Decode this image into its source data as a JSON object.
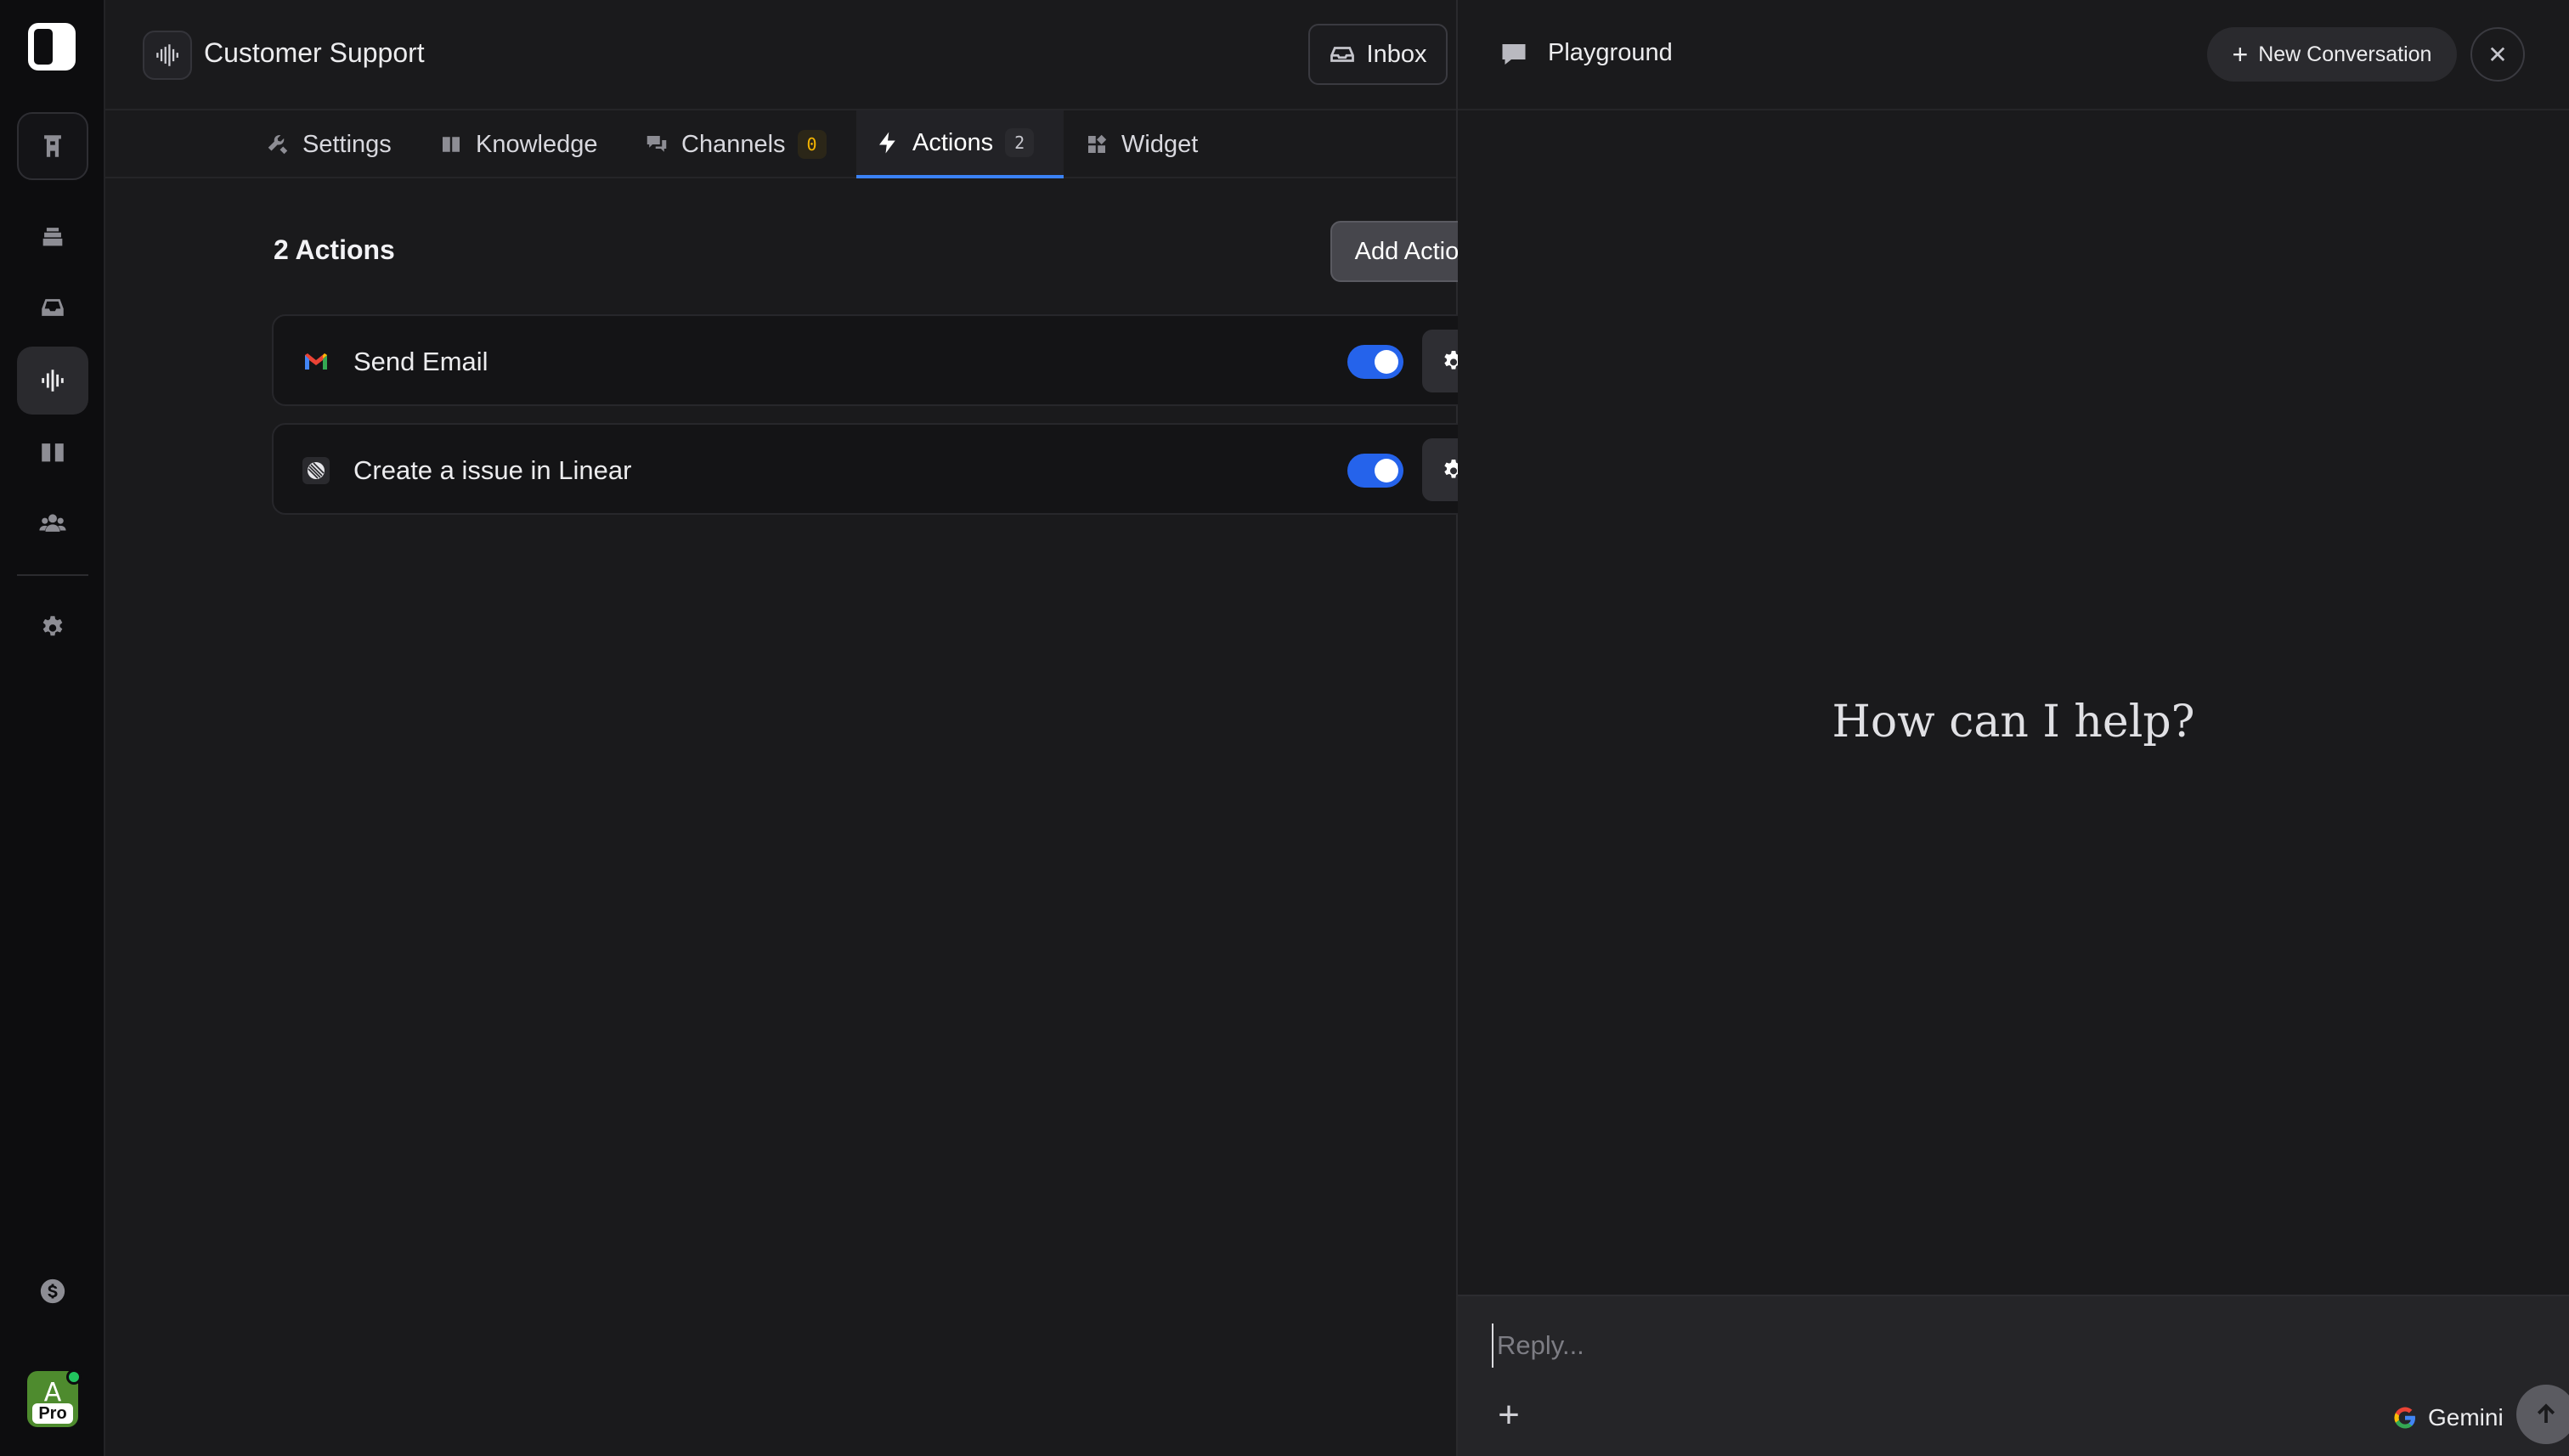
{
  "agent": {
    "title": "Customer Support"
  },
  "header": {
    "inbox_label": "Inbox"
  },
  "tabs": [
    {
      "label": "Settings"
    },
    {
      "label": "Knowledge"
    },
    {
      "label": "Channels",
      "badge": "0"
    },
    {
      "label": "Actions",
      "badge": "2"
    },
    {
      "label": "Widget"
    }
  ],
  "actions_section": {
    "title": "2 Actions",
    "add_label": "Add Action",
    "items": [
      {
        "name": "Send Email",
        "icon": "gmail-icon",
        "enabled": true
      },
      {
        "name": "Create a issue in Linear",
        "icon": "linear-icon",
        "enabled": true
      }
    ]
  },
  "playground": {
    "title": "Playground",
    "new_conversation_label": "New Conversation",
    "close_glyph": "✕",
    "greeting": "How can I help?",
    "reply_placeholder": "Reply...",
    "attach_glyph": "+",
    "model_label": "Gemini"
  },
  "avatar": {
    "letter": "A",
    "plan": "Pro"
  },
  "colors": {
    "accent": "#3b82f6",
    "toggle_on": "#2563eb",
    "channels_badge": "#f5b400",
    "online": "#22c55e"
  }
}
